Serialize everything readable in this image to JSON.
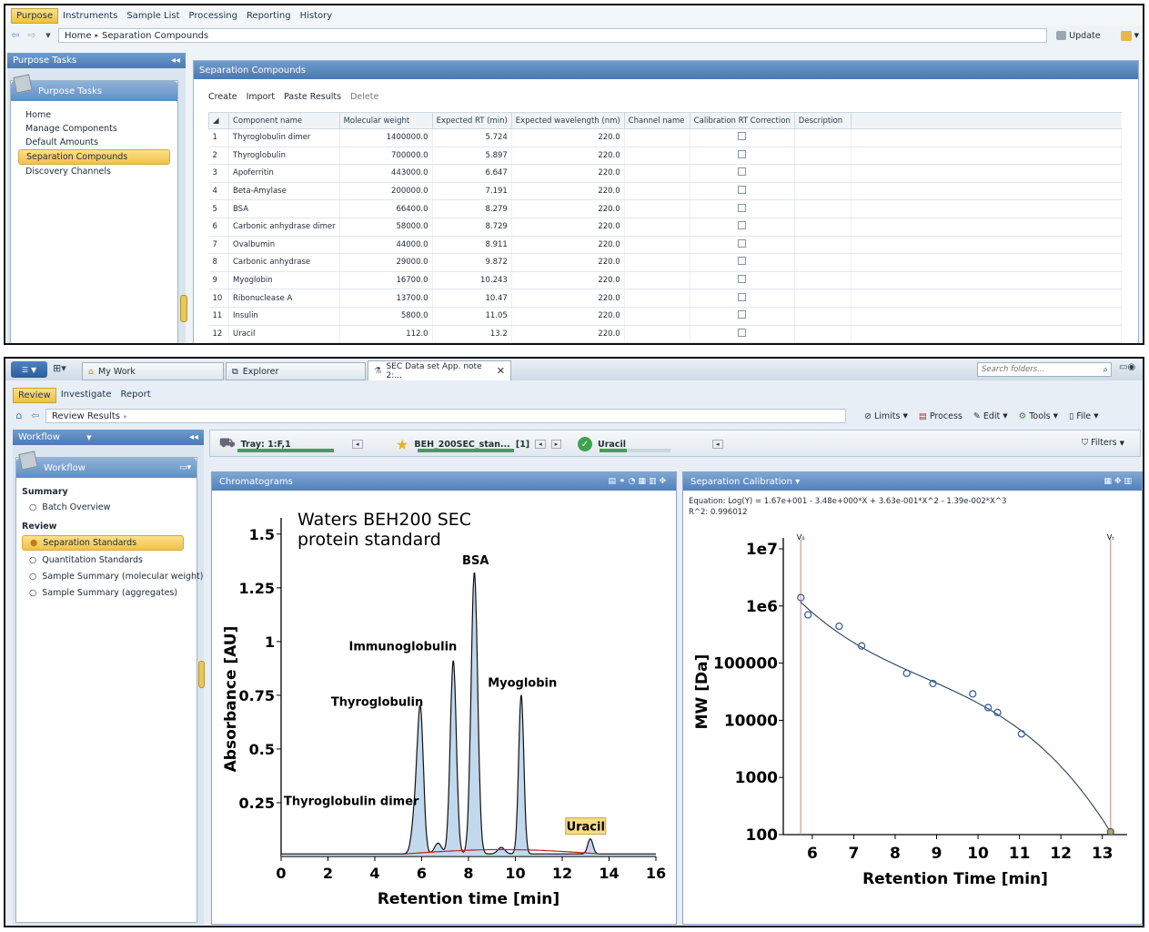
{
  "top": {
    "tabs": [
      "Purpose",
      "Instruments",
      "Sample List",
      "Processing",
      "Reporting",
      "History"
    ],
    "breadcrumb": {
      "home": "Home",
      "sep": "▸",
      "current": "Separation Compounds"
    },
    "update_label": "Update",
    "sidebar_title": "Purpose Tasks",
    "sidebar_group": "Purpose Tasks",
    "nav": [
      "Home",
      "Manage Components",
      "Default Amounts",
      "Separation Compounds",
      "Discovery Channels"
    ],
    "main_title": "Separation Compounds",
    "actions": [
      "Create",
      "Import",
      "Paste Results",
      "Delete"
    ],
    "columns": [
      "Component name",
      "Molecular weight",
      "Expected RT (min)",
      "Expected wavelength (nm)",
      "Channel name",
      "Calibration RT Correction",
      "Description"
    ],
    "rows": [
      {
        "n": "1",
        "name": "Thyroglobulin dimer",
        "mw": "1400000.0",
        "rt": "5.724",
        "wl": "220.0"
      },
      {
        "n": "2",
        "name": "Thyroglobulin",
        "mw": "700000.0",
        "rt": "5.897",
        "wl": "220.0"
      },
      {
        "n": "3",
        "name": "Apoferritin",
        "mw": "443000.0",
        "rt": "6.647",
        "wl": "220.0"
      },
      {
        "n": "4",
        "name": "Beta-Amylase",
        "mw": "200000.0",
        "rt": "7.191",
        "wl": "220.0"
      },
      {
        "n": "5",
        "name": "BSA",
        "mw": "66400.0",
        "rt": "8.279",
        "wl": "220.0"
      },
      {
        "n": "6",
        "name": "Carbonic anhydrase dimer",
        "mw": "58000.0",
        "rt": "8.729",
        "wl": "220.0"
      },
      {
        "n": "7",
        "name": "Ovalbumin",
        "mw": "44000.0",
        "rt": "8.911",
        "wl": "220.0"
      },
      {
        "n": "8",
        "name": "Carbonic anhydrase",
        "mw": "29000.0",
        "rt": "9.872",
        "wl": "220.0"
      },
      {
        "n": "9",
        "name": "Myoglobin",
        "mw": "16700.0",
        "rt": "10.243",
        "wl": "220.0"
      },
      {
        "n": "10",
        "name": "Ribonuclease A",
        "mw": "13700.0",
        "rt": "10.47",
        "wl": "220.0"
      },
      {
        "n": "11",
        "name": "Insulin",
        "mw": "5800.0",
        "rt": "11.05",
        "wl": "220.0"
      },
      {
        "n": "12",
        "name": "Uracil",
        "mw": "112.0",
        "rt": "13.2",
        "wl": "220.0"
      }
    ]
  },
  "bottom": {
    "doc_tabs": [
      "My Work",
      "Explorer",
      "SEC Data set App. note 2:..."
    ],
    "search_placeholder": "Search folders...",
    "tabs": [
      "Review",
      "Investigate",
      "Report"
    ],
    "crumb": "Review Results",
    "toolbar": [
      "Limits",
      "Process",
      "Edit",
      "Tools",
      "File"
    ],
    "sidebar_title": "Workflow",
    "sidebar_group": "Workflow",
    "summary_heading": "Summary",
    "summary_items": [
      "Batch Overview"
    ],
    "review_heading": "Review",
    "review_items": [
      "Separation Standards",
      "Quantitation Standards",
      "Sample Summary (molecular weight)",
      "Sample Summary (aggregates)"
    ],
    "selectors": {
      "tray": "Tray: 1:F,1",
      "injection": "BEH_200SEC_stan...",
      "injection_count": "[1]",
      "component": "Uracil",
      "filters": "Filters"
    },
    "chromatogram_title": "Chromatograms",
    "calibration_title": "Separation Calibration ▾",
    "equation": "Equation: Log(Y) = 1.67e+001 - 3.48e+000*X + 3.63e-001*X^2 - 1.39e-002*X^3",
    "r2": "R^2: 0.996012"
  },
  "chart_data": [
    {
      "type": "line",
      "title": "Waters BEH200 SEC\nprotein standard",
      "xlabel": "Retention time [min]",
      "ylabel": "Absorbance [AU]",
      "xlim": [
        0,
        16
      ],
      "ylim": [
        0,
        1.55
      ],
      "x_ticks": [
        0,
        2,
        4,
        6,
        8,
        10,
        12,
        14,
        16
      ],
      "y_ticks": [
        0.25,
        0.5,
        0.75,
        1,
        1.25,
        1.5
      ],
      "peaks": [
        {
          "label": "Thyroglobulin dimer",
          "rt": 5.72,
          "height": 0.18
        },
        {
          "label": "Thyroglobulin",
          "rt": 5.95,
          "height": 0.64
        },
        {
          "label": "Immunoglobulin",
          "rt": 7.35,
          "height": 0.9
        },
        {
          "label": "BSA",
          "rt": 8.25,
          "height": 1.31
        },
        {
          "label": "Myoglobin",
          "rt": 10.25,
          "height": 0.74
        },
        {
          "label": "Uracil",
          "rt": 13.2,
          "height": 0.07
        }
      ],
      "color": "#3d6f98"
    },
    {
      "type": "scatter",
      "xlabel": "Retention Time [min]",
      "ylabel": "MW [Da]",
      "yscale": "log",
      "xlim": [
        5.3,
        13.6
      ],
      "ylim": [
        100,
        10000000
      ],
      "x_ticks": [
        6,
        7,
        8,
        9,
        10,
        11,
        12,
        13
      ],
      "y_ticks": [
        "100",
        "1000",
        "10000",
        "100000",
        "1e6",
        "1e7"
      ],
      "markers": [
        {
          "label": "V₀",
          "x": 5.72
        },
        {
          "label": "Vₜ",
          "x": 13.2
        }
      ],
      "points": [
        [
          5.724,
          1400000
        ],
        [
          5.897,
          700000
        ],
        [
          6.647,
          443000
        ],
        [
          7.191,
          200000
        ],
        [
          8.279,
          66400
        ],
        [
          8.911,
          44000
        ],
        [
          9.872,
          29000
        ],
        [
          10.243,
          16700
        ],
        [
          10.47,
          13700
        ],
        [
          11.05,
          5800
        ],
        [
          13.2,
          112
        ]
      ],
      "fit": [
        16.7,
        -3.48,
        0.363,
        -0.0139
      ]
    }
  ]
}
